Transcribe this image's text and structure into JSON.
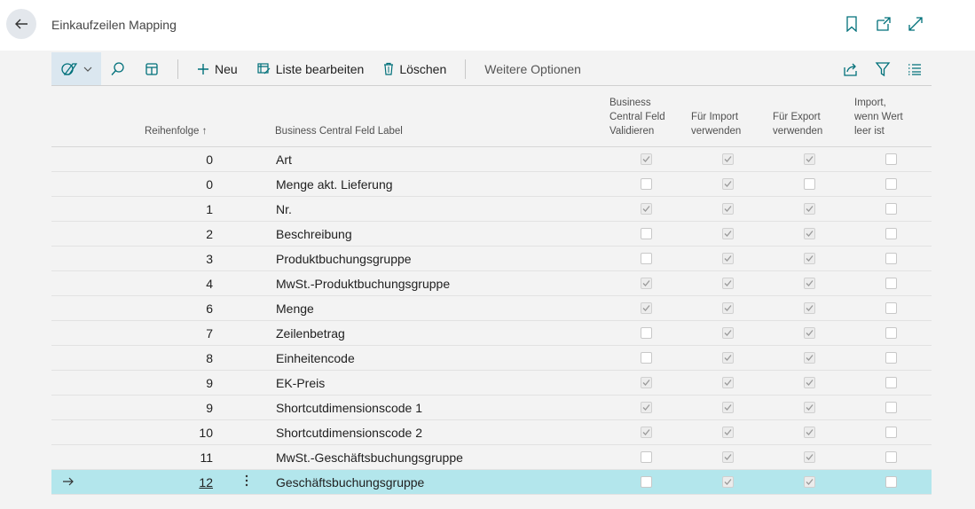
{
  "page": {
    "title": "Einkaufzeilen Mapping"
  },
  "actions": {
    "new_label": "Neu",
    "edit_list_label": "Liste bearbeiten",
    "delete_label": "Löschen",
    "more_options_label": "Weitere Optionen"
  },
  "icons": {
    "back": "back-arrow-icon",
    "bookmark": "bookmark-icon",
    "open_new_window": "open-new-window-icon",
    "expand": "expand-icon",
    "views": "views-icon",
    "search": "search-icon",
    "show_columns": "columns-icon",
    "share": "share-icon",
    "filter": "filter-icon",
    "list": "list-icon",
    "row_menu": "more-vertical-icon",
    "selected": "row-arrow-icon"
  },
  "columns": {
    "sequence": "Reihenfolge ↑",
    "field_label": "Business Central Feld Label",
    "validate": [
      "Business",
      "Central Feld",
      "Validieren"
    ],
    "use_import": [
      "Für Import",
      "verwenden"
    ],
    "use_export": [
      "Für Export",
      "verwenden"
    ],
    "import_if_empty": [
      "Import,",
      "wenn Wert",
      "leer ist"
    ]
  },
  "rows": [
    {
      "seq": "0",
      "label": "Art",
      "validate": true,
      "import": true,
      "export": true,
      "empty": false
    },
    {
      "seq": "0",
      "label": "Menge akt. Lieferung",
      "validate": false,
      "import": true,
      "export": false,
      "empty": false
    },
    {
      "seq": "1",
      "label": "Nr.",
      "validate": true,
      "import": true,
      "export": true,
      "empty": false
    },
    {
      "seq": "2",
      "label": "Beschreibung",
      "validate": false,
      "import": true,
      "export": true,
      "empty": false
    },
    {
      "seq": "3",
      "label": "Produktbuchungsgruppe",
      "validate": false,
      "import": true,
      "export": true,
      "empty": false
    },
    {
      "seq": "4",
      "label": "MwSt.-Produktbuchungsgruppe",
      "validate": true,
      "import": true,
      "export": true,
      "empty": false
    },
    {
      "seq": "6",
      "label": "Menge",
      "validate": true,
      "import": true,
      "export": true,
      "empty": false
    },
    {
      "seq": "7",
      "label": "Zeilenbetrag",
      "validate": false,
      "import": true,
      "export": true,
      "empty": false
    },
    {
      "seq": "8",
      "label": "Einheitencode",
      "validate": false,
      "import": true,
      "export": true,
      "empty": false
    },
    {
      "seq": "9",
      "label": "EK-Preis",
      "validate": true,
      "import": true,
      "export": true,
      "empty": false
    },
    {
      "seq": "9",
      "label": "Shortcutdimensionscode 1",
      "validate": true,
      "import": true,
      "export": true,
      "empty": false
    },
    {
      "seq": "10",
      "label": "Shortcutdimensionscode 2",
      "validate": true,
      "import": true,
      "export": true,
      "empty": false
    },
    {
      "seq": "11",
      "label": "MwSt.-Geschäftsbuchungsgruppe",
      "validate": false,
      "import": true,
      "export": true,
      "empty": false
    },
    {
      "seq": "12",
      "label": "Geschäftsbuchungsgruppe",
      "validate": false,
      "import": true,
      "export": true,
      "empty": false,
      "selected": true
    }
  ],
  "colors": {
    "accent": "#00707a",
    "selected_row": "#b3e6ec",
    "view_switch_bg": "#dbe7f0"
  }
}
